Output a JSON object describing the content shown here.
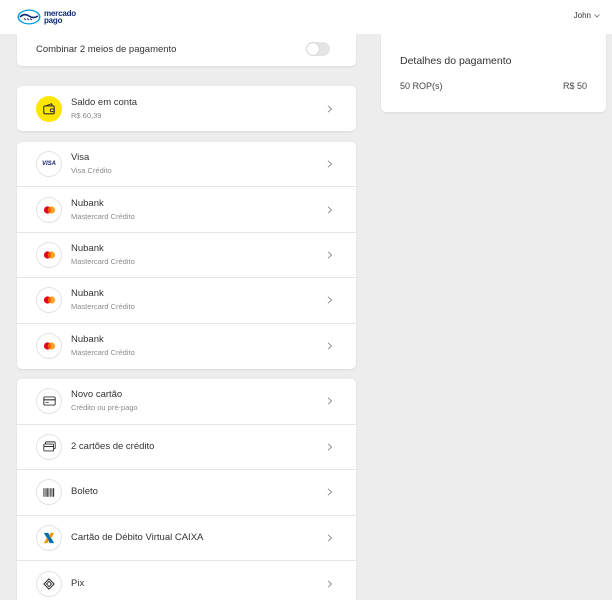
{
  "header": {
    "logo_line1": "mercado",
    "logo_line2": "pago",
    "user_name": "John"
  },
  "combine": {
    "label": "Combinar 2 meios de pagamento",
    "enabled": false
  },
  "balance": {
    "title": "Saldo em conta",
    "amount": "R$ 60,39",
    "icon": "wallet-icon",
    "icon_bg": "#ffe600"
  },
  "cards": [
    {
      "title": "Visa",
      "subtitle": "Visa Crédito",
      "icon": "visa-icon",
      "icon_text": "VISA"
    },
    {
      "title": "Nubank",
      "subtitle": "Mastercard Crédito",
      "icon": "mastercard-icon"
    },
    {
      "title": "Nubank",
      "subtitle": "Mastercard Crédito",
      "icon": "mastercard-icon"
    },
    {
      "title": "Nubank",
      "subtitle": "Mastercard Crédito",
      "icon": "mastercard-icon"
    },
    {
      "title": "Nubank",
      "subtitle": "Mastercard Crédito",
      "icon": "mastercard-icon"
    }
  ],
  "other_methods": [
    {
      "title": "Novo cartão",
      "subtitle": "Crédito ou pré-pago",
      "icon": "credit-card-icon"
    },
    {
      "title": "2 cartões de crédito",
      "icon": "two-cards-icon"
    },
    {
      "title": "Boleto",
      "icon": "barcode-icon"
    },
    {
      "title": "Cartão de Débito Virtual CAIXA",
      "icon": "caixa-icon"
    },
    {
      "title": "Pix",
      "icon": "pix-icon"
    }
  ],
  "details": {
    "title": "Detalhes do pagamento",
    "item_label": "50 ROP(s)",
    "item_value": "R$ 50"
  },
  "colors": {
    "brand_blue": "#0d2d7a",
    "visa_blue": "#1a1f71",
    "mc_red": "#eb001b",
    "mc_orange": "#f79e1b",
    "caixa_orange": "#f39200",
    "caixa_blue": "#0070af"
  }
}
